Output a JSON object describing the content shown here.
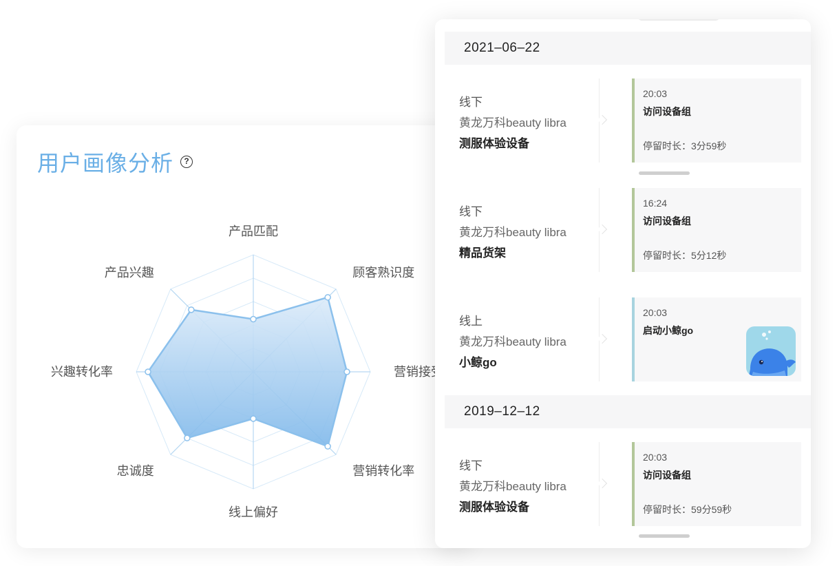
{
  "radar": {
    "title": "用户画像分析",
    "help_icon": "question-circle-icon",
    "axes": [
      "产品匹配",
      "顾客熟识度",
      "营销接受",
      "营销转化率",
      "线上偏好",
      "忠诚度",
      "兴趣转化率",
      "产品兴趣"
    ],
    "values": [
      0.45,
      0.9,
      0.8,
      0.9,
      0.4,
      0.8,
      0.9,
      0.75
    ],
    "colors": {
      "fill": "#8ec2ee",
      "stroke": "#8bc0ec",
      "grid": "#d6e9f8",
      "title": "#6aafe6"
    }
  },
  "timeline": {
    "groups": [
      {
        "date": "2021–06–22",
        "entries": [
          {
            "channel": "线下",
            "store": "黄龙万科beauty libra",
            "device": "测服体验设备",
            "time": "20:03",
            "action": "访问设备组",
            "stay": "停留时长：3分59秒",
            "type": "offline"
          },
          {
            "channel": "线下",
            "store": "黄龙万科beauty libra",
            "device": "精品货架",
            "time": "16:24",
            "action": "访问设备组",
            "stay": "停留时长：5分12秒",
            "type": "offline"
          },
          {
            "channel": "线上",
            "store": "黄龙万科beauty libra",
            "device": "小鲸go",
            "time": "20:03",
            "action": "启动小鲸go",
            "stay": "",
            "type": "online",
            "thumbnail": "whale-app-icon"
          }
        ]
      },
      {
        "date": "2019–12–12",
        "entries": [
          {
            "channel": "线下",
            "store": "黄龙万科beauty libra",
            "device": "测服体验设备",
            "time": "20:03",
            "action": "访问设备组",
            "stay": "停留时长：59分59秒",
            "type": "offline"
          }
        ]
      }
    ]
  }
}
